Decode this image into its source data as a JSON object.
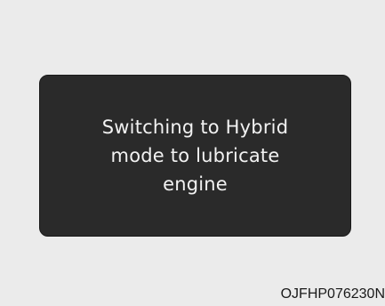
{
  "display": {
    "lines": [
      "Switching to Hybrid",
      "mode to lubricate",
      "engine"
    ]
  },
  "figure": {
    "code": "OJFHP076230N"
  }
}
